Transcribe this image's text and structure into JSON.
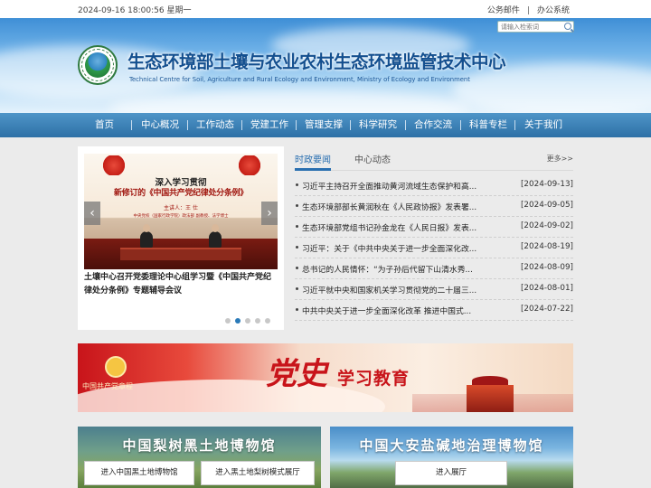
{
  "topbar": {
    "datetime": "2024-09-16 18:00:56 星期一",
    "links": [
      "公务邮件",
      "办公系统"
    ],
    "separator": "|"
  },
  "header": {
    "search_placeholder": "请输入检索词",
    "title_cn": "生态环境部土壤与农业农村生态环境监管技术中心",
    "title_en": "Technical Centre for Soil, Agriculture and Rural Ecology and Environment, Ministry of Ecology and Environment"
  },
  "nav": {
    "items": [
      "首页",
      "中心概况",
      "工作动态",
      "党建工作",
      "管理支撑",
      "科学研究",
      "合作交流",
      "科普专栏",
      "关于我们"
    ]
  },
  "slider": {
    "image_text": {
      "line1": "深入学习贯彻",
      "line2": "新修订的《中国共产党纪律处分条例》",
      "line3": "主讲人：王  仕",
      "line4": "中央党校（国家行政学院）政法部 副教授、法学博士"
    },
    "prev_icon": "‹",
    "next_icon": "›",
    "caption": "土壤中心召开党委理论中心组学习暨《中国共产党纪律处分条例》专题辅导会议",
    "dot_count": 5,
    "active_dot": 1
  },
  "news": {
    "tabs": [
      "时政要闻",
      "中心动态"
    ],
    "active_tab": 0,
    "more_label": "更多>>",
    "items": [
      {
        "title": "习近平主持召开全面推动黄河流域生态保护和高...",
        "date": "[2024-09-13]"
      },
      {
        "title": "生态环境部部长黄润秋在《人民政协报》发表署...",
        "date": "[2024-09-05]"
      },
      {
        "title": "生态环境部党组书记孙金龙在《人民日报》发表...",
        "date": "[2024-09-02]"
      },
      {
        "title": "习近平：关于《中共中央关于进一步全面深化改...",
        "date": "[2024-08-19]"
      },
      {
        "title": "总书记的人民情怀：“为子孙后代留下山清水秀...",
        "date": "[2024-08-09]"
      },
      {
        "title": "习近平就中央和国家机关学习贯彻党的二十届三...",
        "date": "[2024-08-01]"
      },
      {
        "title": "中共中央关于进一步全面深化改革 推进中国式...",
        "date": "[2024-07-22]"
      }
    ]
  },
  "banner": {
    "book_text": "中国共产党章程",
    "dangshi": "党史",
    "xuexi": "学习教育"
  },
  "museums": [
    {
      "title": "中国梨树黑土地博物馆",
      "buttons": [
        "进入中国黑土地博物馆",
        "进入黑土地梨树模式展厅"
      ]
    },
    {
      "title": "中国大安盐碱地治理博物馆",
      "buttons": [
        "进入展厅"
      ]
    }
  ],
  "colors": {
    "nav_bg": "#2d70a6",
    "accent": "#2a6fb0",
    "title": "#134f8f",
    "party_red": "#c8141a"
  }
}
